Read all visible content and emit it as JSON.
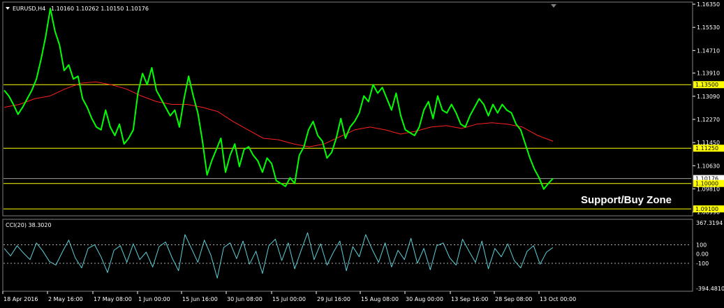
{
  "header": {
    "symbol": "EURUSD,H4",
    "ohlc": "1.10160 1.10262 1.10150 1.10176"
  },
  "annotation": {
    "text": "Support/Buy Zone"
  },
  "colors": {
    "background": "#000000",
    "price": "#00ff00",
    "ma": "#ff2020",
    "levels": "#ffff00",
    "level_label_bg": "#ffff00",
    "cci": "#5ecfd6",
    "axis": "#ffffff"
  },
  "chart_data": [
    {
      "type": "line",
      "title": "EURUSD,H4",
      "ylim": [
        1.0888,
        1.164
      ],
      "y_ticks": [
        "1.16350",
        "1.15530",
        "1.14710",
        "1.13910",
        "1.13090",
        "1.12270",
        "1.11450",
        "1.10630",
        "1.09810",
        "1.08990"
      ],
      "y_tick_values": [
        1.1635,
        1.1553,
        1.1471,
        1.1391,
        1.1309,
        1.1227,
        1.1145,
        1.1063,
        1.0981,
        1.0899
      ],
      "current_price": "1.10176",
      "horizontal_levels": [
        {
          "value": 1.135,
          "label": "1.13500"
        },
        {
          "value": 1.1125,
          "label": "1.11250"
        },
        {
          "value": 1.1,
          "label": "1.10000"
        },
        {
          "value": 1.091,
          "label": "1.09100"
        }
      ],
      "x_ticks": [
        "18 Apr 2016",
        "2 May 16:00",
        "17 May 08:00",
        "1 Jun 00:00",
        "15 Jun 16:00",
        "30 Jun 08:00",
        "15 Jul 00:00",
        "29 Jul 16:00",
        "15 Aug 08:00",
        "30 Aug 00:00",
        "13 Sep 16:00",
        "28 Sep 08:00",
        "13 Oct 00:00"
      ],
      "series": [
        {
          "key": "price",
          "values": [
            1.133,
            1.131,
            1.128,
            1.1245,
            1.127,
            1.13,
            1.133,
            1.137,
            1.144,
            1.152,
            1.162,
            1.154,
            1.149,
            1.14,
            1.142,
            1.137,
            1.138,
            1.13,
            1.127,
            1.123,
            1.12,
            1.119,
            1.126,
            1.12,
            1.117,
            1.121,
            1.114,
            1.116,
            1.119,
            1.132,
            1.139,
            1.135,
            1.141,
            1.133,
            1.13,
            1.127,
            1.124,
            1.126,
            1.12,
            1.13,
            1.138,
            1.131,
            1.125,
            1.115,
            1.103,
            1.108,
            1.112,
            1.116,
            1.104,
            1.11,
            1.114,
            1.106,
            1.112,
            1.113,
            1.11,
            1.108,
            1.104,
            1.109,
            1.107,
            1.101,
            1.1,
            1.099,
            1.102,
            1.1,
            1.11,
            1.113,
            1.119,
            1.122,
            1.117,
            1.115,
            1.109,
            1.111,
            1.116,
            1.123,
            1.116,
            1.12,
            1.122,
            1.125,
            1.131,
            1.129,
            1.135,
            1.132,
            1.134,
            1.13,
            1.126,
            1.132,
            1.124,
            1.119,
            1.118,
            1.117,
            1.12,
            1.126,
            1.129,
            1.123,
            1.131,
            1.126,
            1.125,
            1.128,
            1.125,
            1.121,
            1.12,
            1.124,
            1.127,
            1.13,
            1.128,
            1.124,
            1.128,
            1.125,
            1.128,
            1.126,
            1.125,
            1.121,
            1.119,
            1.114,
            1.109,
            1.105,
            1.102,
            1.098,
            1.1,
            1.1018
          ],
          "color": "#00ff00"
        },
        {
          "key": "ma",
          "values": [
            1.127,
            1.128,
            1.13,
            1.131,
            1.1335,
            1.1355,
            1.136,
            1.135,
            1.1335,
            1.131,
            1.129,
            1.128,
            1.128,
            1.127,
            1.1255,
            1.122,
            1.119,
            1.116,
            1.1155,
            1.114,
            1.113,
            1.114,
            1.1165,
            1.119,
            1.12,
            1.119,
            1.1175,
            1.1185,
            1.12,
            1.1205,
            1.1195,
            1.121,
            1.1215,
            1.121,
            1.12,
            1.117,
            1.115
          ],
          "color": "#ff2020"
        },
        {
          "key": "cci",
          "values": [
            60,
            -20,
            90,
            10,
            -60,
            120,
            30,
            -80,
            -120,
            20,
            150,
            -40,
            -150,
            60,
            100,
            -30,
            -200,
            40,
            90,
            -90,
            110,
            -60,
            20,
            -140,
            80,
            130,
            -40,
            -180,
            210,
            60,
            -90,
            150,
            -10,
            -260,
            70,
            120,
            -50,
            140,
            -110,
            30,
            -210,
            90,
            160,
            -70,
            120,
            -160,
            40,
            230,
            -60,
            110,
            -120,
            20,
            140,
            -180,
            80,
            -30,
            210,
            50,
            -90,
            120,
            -140,
            40,
            -60,
            170,
            -100,
            60,
            -170,
            90,
            120,
            -40,
            -120,
            160,
            30,
            -90,
            140,
            -160,
            60,
            -30,
            110,
            -70,
            -150,
            30,
            90,
            -110,
            20,
            70
          ],
          "color": "#5ecfd6"
        }
      ]
    },
    {
      "type": "line",
      "title": "CCI(20) 38.3020",
      "ylim": [
        -394.481,
        367.3194
      ],
      "y_ticks": [
        "367.3194",
        "100",
        "0.00",
        "-100",
        "-394.4810"
      ],
      "reference_lines": [
        100,
        -100
      ]
    }
  ]
}
